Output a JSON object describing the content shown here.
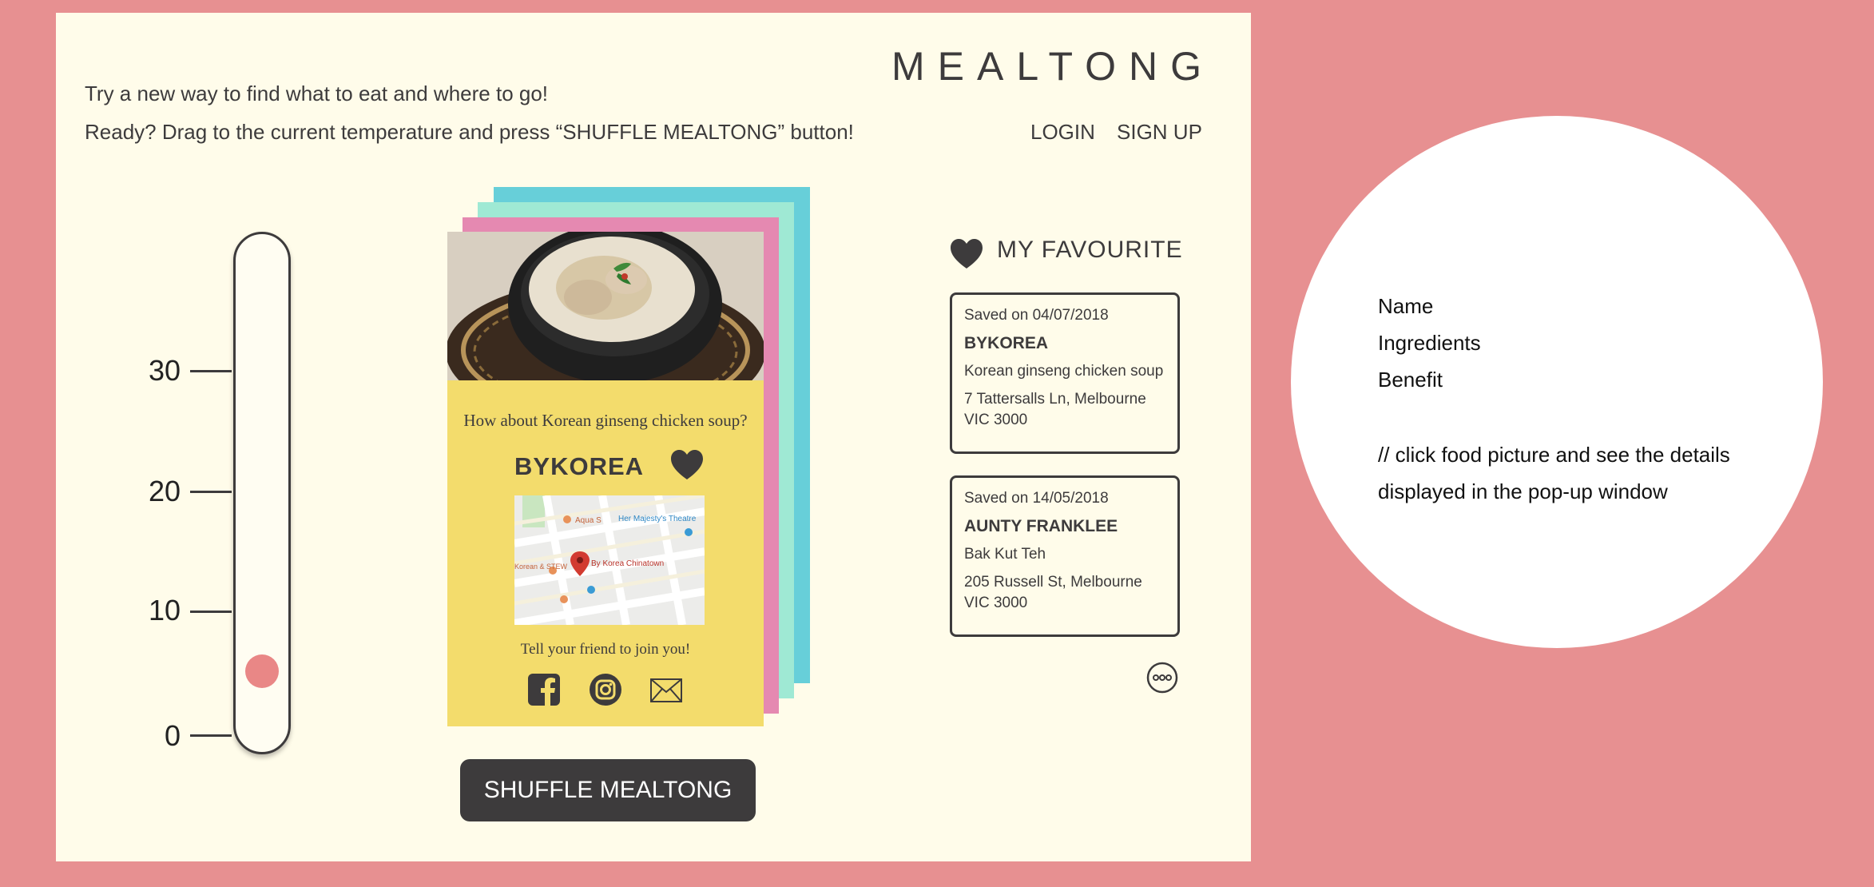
{
  "header": {
    "brand": "MEALTONG",
    "intro_line1": "Try a new way to find what to eat and where to go!",
    "intro_line2": "Ready? Drag to the current temperature and press “SHUFFLE MEALTONG” button!",
    "login_label": "LOGIN",
    "signup_label": "SIGN UP"
  },
  "thermometer": {
    "ticks": [
      "30",
      "20",
      "10",
      "0"
    ],
    "min": 0,
    "max": 30,
    "current_value": 5,
    "knob_color": "#e98786"
  },
  "card": {
    "question": "How about Korean ginseng chicken soup?",
    "restaurant": "BYKOREA",
    "map": {
      "labels": [
        "Aqua S",
        "Her Majesty's Theatre",
        "By Korea Chinatown",
        "Korean & STEW"
      ]
    },
    "share_prompt": "Tell your friend to join you!",
    "share_icons": [
      "facebook-icon",
      "instagram-icon",
      "mail-icon"
    ],
    "back_card_colors": [
      "#67cfd9",
      "#9fe9d4",
      "#e589b1"
    ],
    "card_color": "#f3dc6c"
  },
  "shuffle_button": {
    "label": "SHUFFLE MEALTONG"
  },
  "favourites": {
    "title": "MY FAVOURITE",
    "items": [
      {
        "saved": "Saved on 04/07/2018",
        "name": "BYKOREA",
        "dish": "Korean ginseng chicken soup",
        "address": "7 Tattersalls Ln, Melbourne VIC 3000"
      },
      {
        "saved": "Saved on 14/05/2018",
        "name": "AUNTY FRANKLEE",
        "dish": "Bak Kut Teh",
        "address": "205 Russell St, Melbourne VIC 3000"
      }
    ],
    "more_icon": "more-icon"
  },
  "popup": {
    "name": "Name",
    "ingredients": "Ingredients",
    "benefit": "Benefit",
    "note_line1": "// click food picture and see the details",
    "note_line2": "displayed in the pop-up window"
  }
}
